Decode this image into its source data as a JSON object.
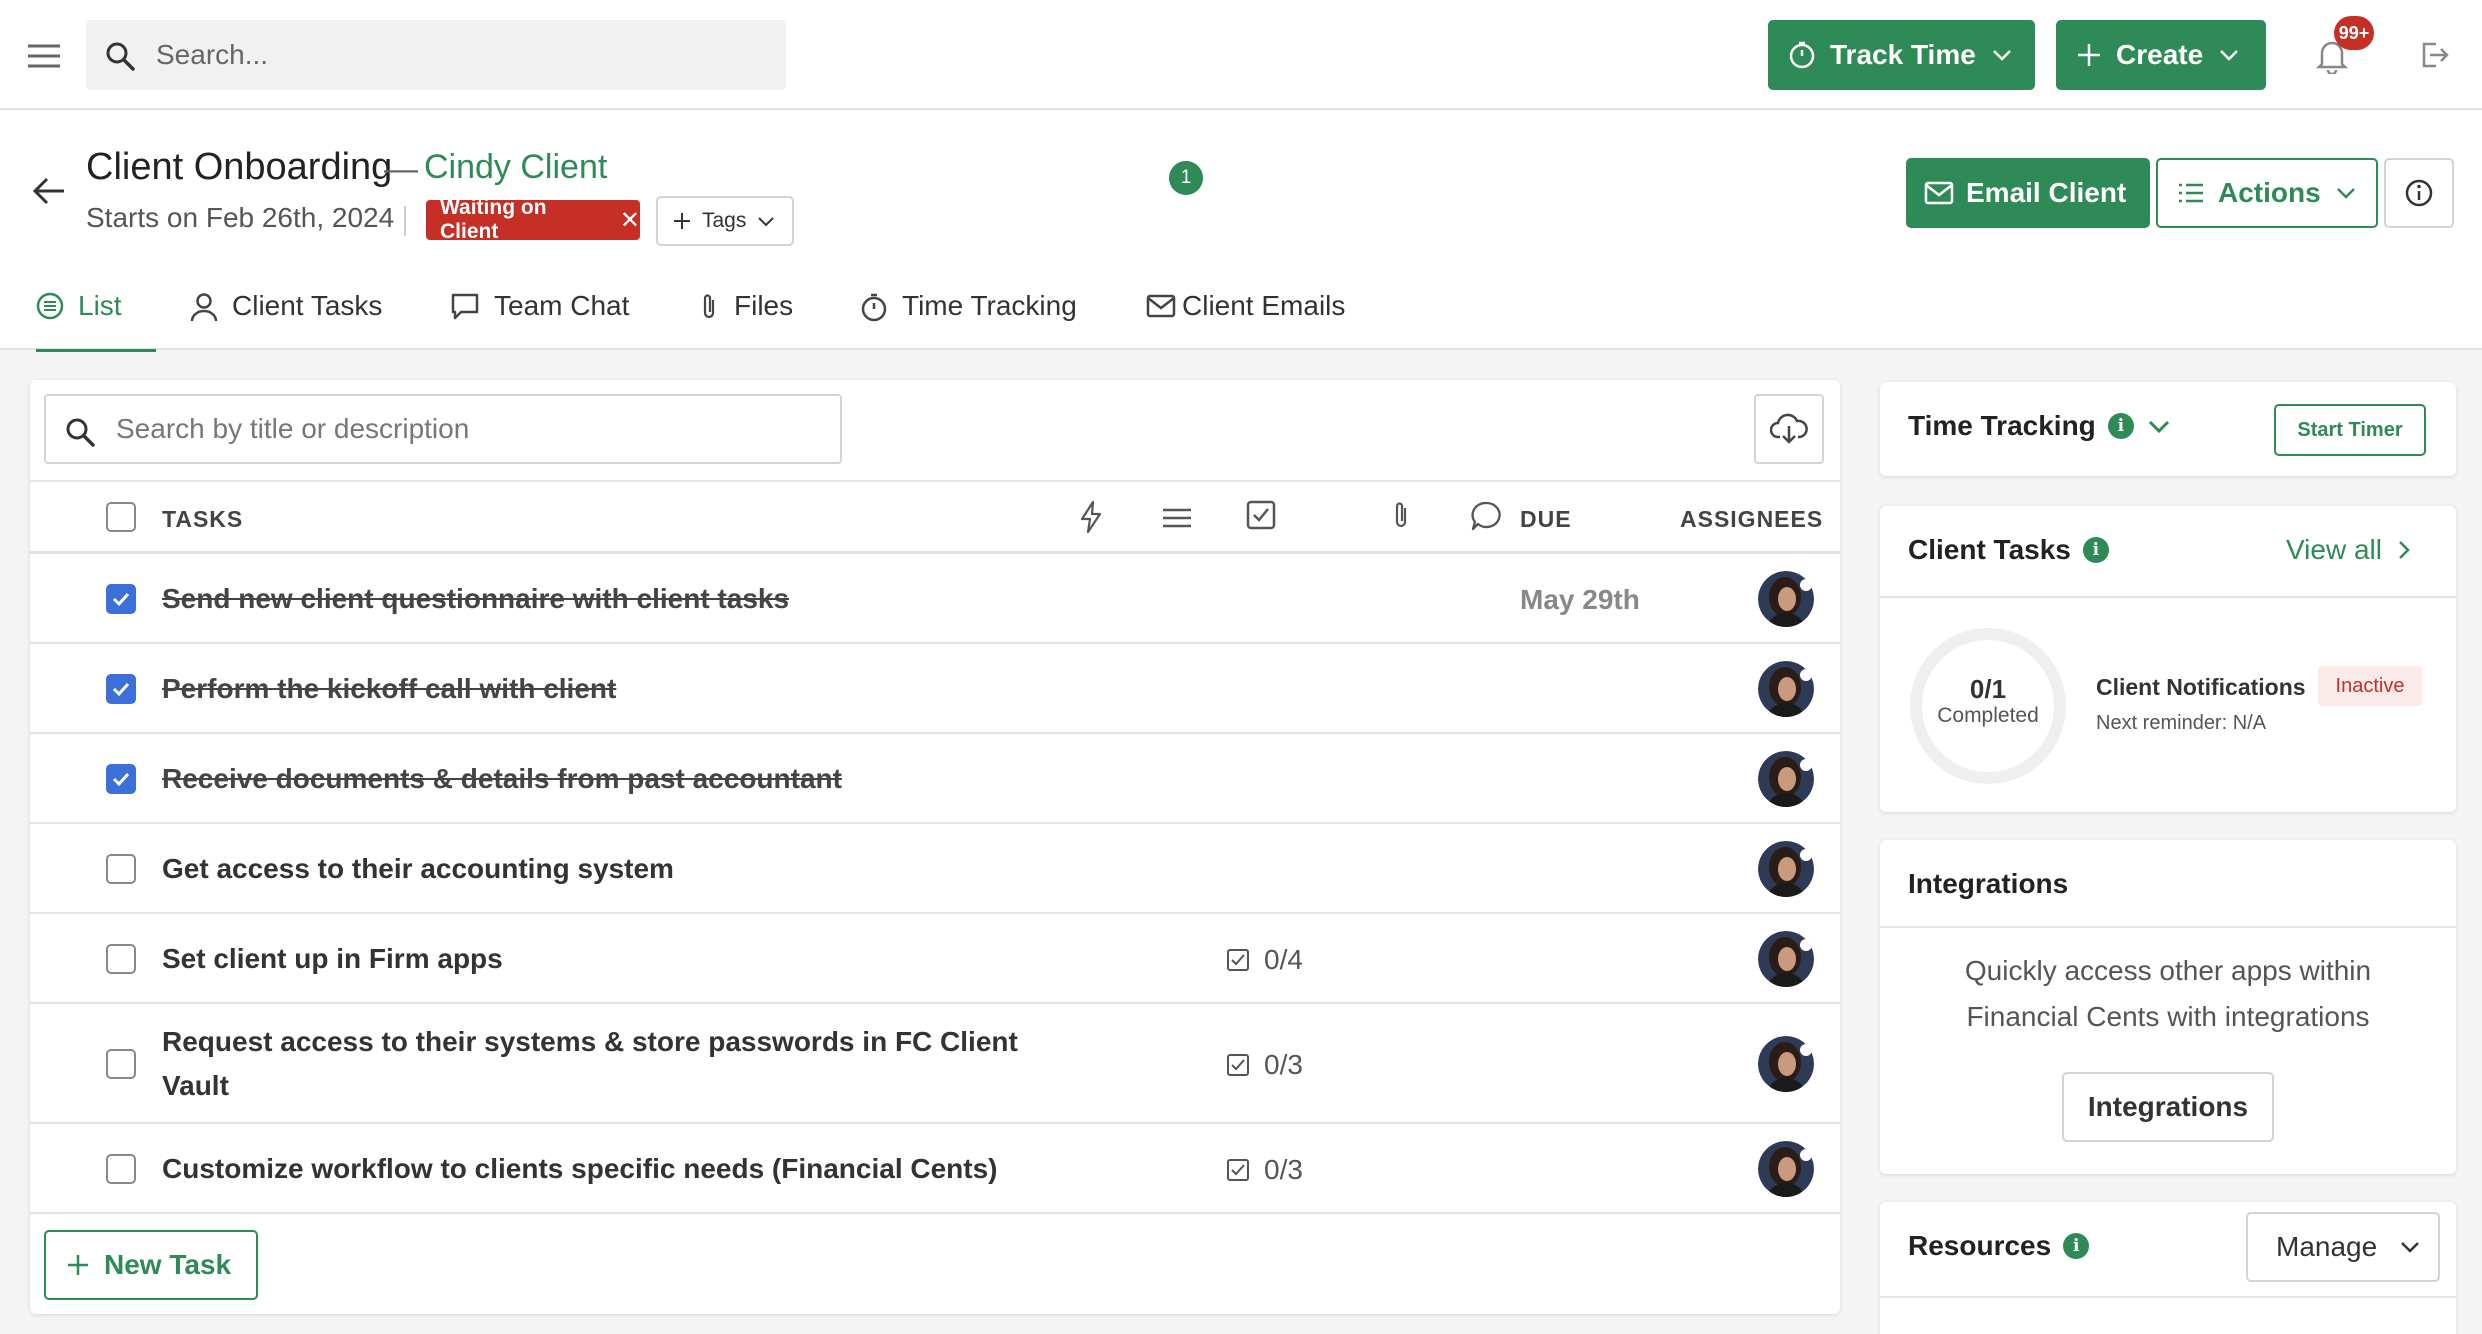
{
  "topbar": {
    "search_placeholder": "Search...",
    "track_time_label": "Track Time",
    "create_label": "Create",
    "notification_count": "99+"
  },
  "header": {
    "title": "Client Onboarding",
    "separator": "—",
    "client_name": "Cindy Client",
    "start_date_text": "Starts on Feb 26th, 2024",
    "status_tag": "Waiting on Client",
    "tags_label": "Tags",
    "email_client_label": "Email Client",
    "actions_label": "Actions"
  },
  "tabs": [
    {
      "label": "List",
      "active": true
    },
    {
      "label": "Client Tasks"
    },
    {
      "label": "Team Chat"
    },
    {
      "label": "Files"
    },
    {
      "label": "Time Tracking"
    },
    {
      "label": "Client Emails",
      "count": "1"
    }
  ],
  "tasks_panel": {
    "search_placeholder": "Search by title or description",
    "col_tasks": "TASKS",
    "col_due": "DUE",
    "col_assignees": "ASSIGNEES",
    "new_task_label": "New Task",
    "rows": [
      {
        "title": "Send new client questionnaire with client tasks",
        "done": true,
        "subtasks": "",
        "due": "May 29th"
      },
      {
        "title": "Perform the kickoff call with client",
        "done": true,
        "subtasks": "",
        "due": ""
      },
      {
        "title": "Receive documents & details from past accountant",
        "done": true,
        "subtasks": "",
        "due": ""
      },
      {
        "title": "Get access to their accounting system",
        "done": false,
        "subtasks": "",
        "due": ""
      },
      {
        "title": "Set client up in Firm apps",
        "done": false,
        "subtasks": "0/4",
        "due": ""
      },
      {
        "title": "Request access to their systems & store passwords in FC Client Vault",
        "done": false,
        "subtasks": "0/3",
        "due": ""
      },
      {
        "title": "Customize workflow to clients specific needs (Financial Cents)",
        "done": false,
        "subtasks": "0/3",
        "due": ""
      }
    ]
  },
  "sidebar": {
    "time_tracking": {
      "title": "Time Tracking",
      "start_timer_label": "Start Timer"
    },
    "client_tasks": {
      "title": "Client Tasks",
      "view_all_label": "View all",
      "completed_count": "0/1",
      "completed_label": "Completed",
      "completed_fraction": 0,
      "notifications_title": "Client Notifications",
      "notifications_status": "Inactive",
      "next_reminder": "Next reminder: N/A"
    },
    "integrations": {
      "title": "Integrations",
      "description": "Quickly access other apps within Financial Cents with integrations",
      "button_label": "Integrations"
    },
    "resources": {
      "title": "Resources",
      "manage_label": "Manage"
    }
  },
  "colors": {
    "brand_green": "#2e8a56",
    "alert_red": "#c62f26",
    "checkbox_blue": "#3d6fd8"
  }
}
